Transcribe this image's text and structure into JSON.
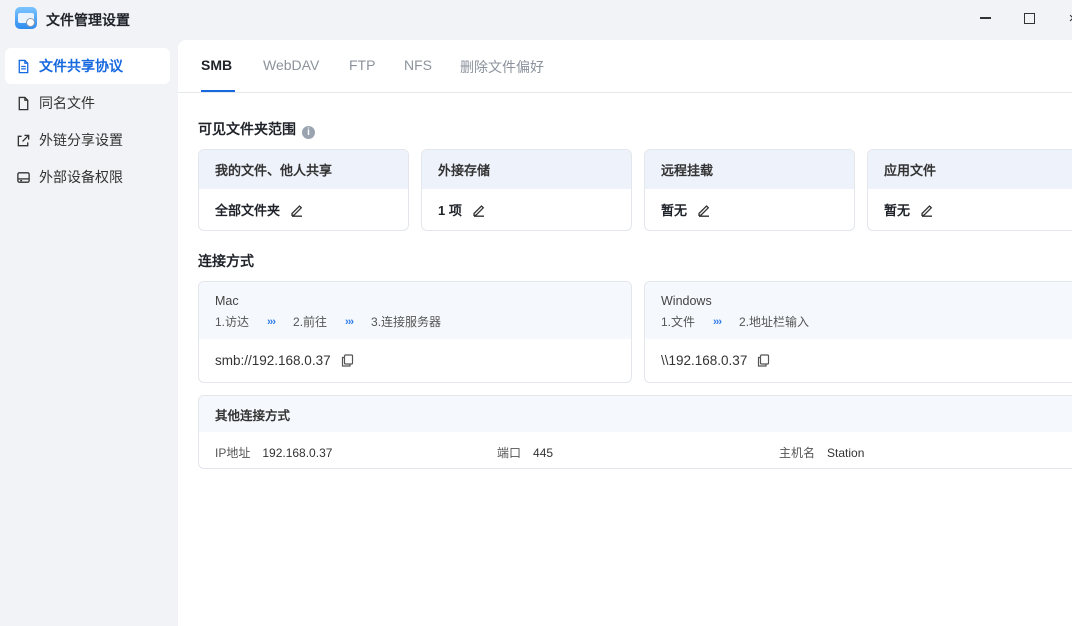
{
  "window": {
    "title": "文件管理设置",
    "close_glyph": "×"
  },
  "sidebar": {
    "items": [
      {
        "label": "文件共享协议",
        "icon": "document-icon",
        "active": true
      },
      {
        "label": "同名文件",
        "icon": "file-icon"
      },
      {
        "label": "外链分享设置",
        "icon": "share-link-icon"
      },
      {
        "label": "外部设备权限",
        "icon": "drive-icon"
      }
    ]
  },
  "tabs": [
    {
      "label": "SMB",
      "active": true
    },
    {
      "label": "WebDAV"
    },
    {
      "label": "FTP"
    },
    {
      "label": "NFS"
    },
    {
      "label": "删除文件偏好"
    }
  ],
  "visible_scope": {
    "title": "可见文件夹范围",
    "info_glyph": "i",
    "cards": [
      {
        "header": "我的文件、他人共享",
        "value": "全部文件夹"
      },
      {
        "header": "外接存储",
        "value": "1 项"
      },
      {
        "header": "远程挂载",
        "value": "暂无"
      },
      {
        "header": "应用文件",
        "value": "暂无"
      }
    ]
  },
  "connection": {
    "title": "连接方式",
    "arrow_glyph": "›››",
    "mac": {
      "os": "Mac",
      "steps": [
        "1.访达",
        "2.前往",
        "3.连接服务器"
      ],
      "address": "smb://192.168.0.37"
    },
    "windows": {
      "os": "Windows",
      "steps": [
        "1.文件",
        "2.地址栏输入"
      ],
      "address": "\\\\192.168.0.37"
    },
    "other": {
      "title": "其他连接方式",
      "ip_label": "IP地址",
      "ip_value": "192.168.0.37",
      "port_label": "端口",
      "port_value": "445",
      "host_label": "主机名",
      "host_value": "Station"
    }
  },
  "colors": {
    "accent": "#1769e0",
    "card_header_bg": "#eef3fb",
    "sidebar_bg": "#f1f3f6"
  }
}
